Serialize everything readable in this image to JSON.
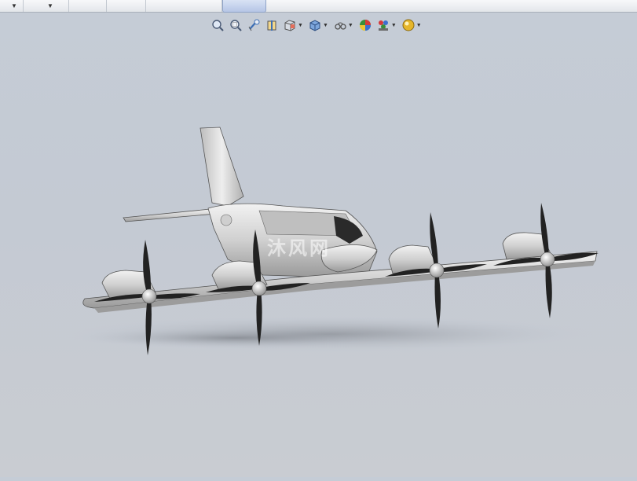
{
  "window": {
    "watermark_text": "沐风网"
  },
  "heads_up_toolbar": {
    "buttons": [
      {
        "icon": "zoom-to-fit-icon"
      },
      {
        "icon": "zoom-to-area-icon"
      },
      {
        "icon": "previous-view-icon"
      },
      {
        "icon": "section-view-icon"
      },
      {
        "icon": "view-orientation-icon",
        "dropdown": true
      },
      {
        "icon": "display-style-icon",
        "dropdown": true
      },
      {
        "icon": "hide-show-items-icon",
        "dropdown": true
      },
      {
        "icon": "edit-appearance-icon"
      },
      {
        "icon": "apply-scene-icon",
        "dropdown": true
      },
      {
        "icon": "view-settings-icon",
        "dropdown": true
      }
    ]
  },
  "colors": {
    "viewport_background": "#c5ccd6",
    "model_metal": "#d9d9d9",
    "propeller_blade": "#1c1c1c",
    "active_tab": "#b6c6e6"
  }
}
